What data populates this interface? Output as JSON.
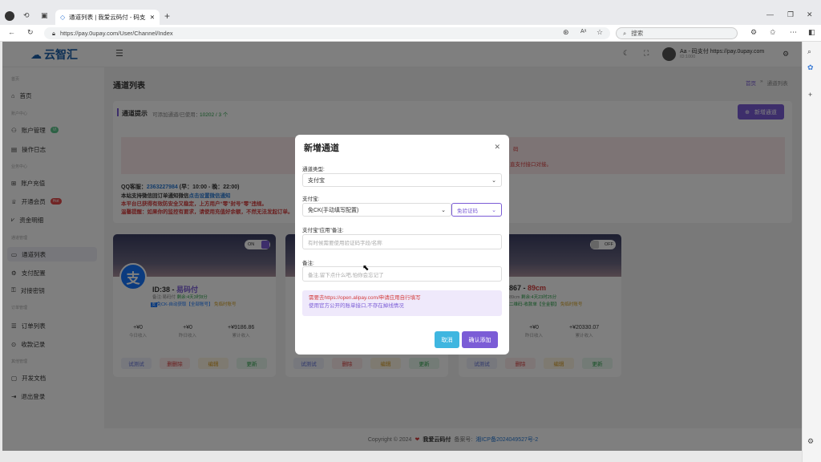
{
  "browser": {
    "tab_title": "通道列表 | 我爱云码付 - 码支二维码",
    "url": "https://pay.0upay.com/User/Channel/Index",
    "search_placeholder": "搜索"
  },
  "header": {
    "logo": "云智汇",
    "user_name": "Aa - 码支付 https://pay.0upay.com",
    "user_id": "ID:1000"
  },
  "sidebar": {
    "groups": [
      "首页",
      "账户中心",
      "业务中心",
      "通道管理",
      "订单管理",
      "其他管理"
    ],
    "items": [
      {
        "label": "首页"
      },
      {
        "label": "账户管理",
        "badge": "VI"
      },
      {
        "label": "操作日志"
      },
      {
        "label": "账户充值"
      },
      {
        "label": "开通会员",
        "badge": "Hot"
      },
      {
        "label": "资金明细"
      },
      {
        "label": "通道列表"
      },
      {
        "label": "支付配置"
      },
      {
        "label": "对接密钥"
      },
      {
        "label": "订单列表"
      },
      {
        "label": "收款记录"
      },
      {
        "label": "开发文档"
      },
      {
        "label": "退出登录"
      }
    ]
  },
  "main": {
    "title": "通道列表",
    "breadcrumb_home": "首页",
    "breadcrumb_current": "通道列表",
    "notice_label": "通道提示",
    "notice_text": "可添加通道/已使用：",
    "notice_count": "10202 / 3 个",
    "add_button": "新增通道",
    "notice_red_1": "码",
    "notice_red_2": "直支付接口对接。",
    "qq_label": "QQ客服：",
    "qq_number": "2363227984",
    "qq_hours": "(早：10:00 - 晚：22:00)",
    "line2_a": "本站支持微信回订单通知微信",
    "line2_b": "点击设置微信通知",
    "line3": "本平台已获得有效防安全又稳定，上方用户“零”封号“零”违规。",
    "line4": "温馨提醒：如果你的监控有要求，请使用充值好余额，不然无法发起订单。"
  },
  "cards": [
    {
      "toggle": "ON",
      "title_id": "ID:38 -",
      "title_name": "易码付",
      "sub1": "备注:易码付",
      "sub1b": "剩余:4天3时8分",
      "sub2": "免CK-自动获取【全部账号】",
      "sub2b": "免临时账号",
      "stats": [
        {
          "v": "+¥0",
          "l": "今日收入"
        },
        {
          "v": "+¥0",
          "l": "昨日收入"
        },
        {
          "v": "+¥9186.86",
          "l": "累计收入"
        }
      ],
      "btns": [
        "试测试",
        "删删除",
        "编辑",
        "更新"
      ]
    },
    {
      "btns": [
        "试测试",
        "删除",
        "编辑",
        "更新"
      ]
    },
    {
      "toggle": "OFF",
      "title_id": "867 -",
      "title_name": "89cm",
      "sub1": "89cm",
      "sub1b": "剩余:4天23时25分",
      "sub2": "二维码-收款单【全金额】",
      "sub2b": "免临时账号",
      "stats": [
        {
          "v": "+¥0",
          "l": "昨日收入"
        },
        {
          "v": "+¥20330.07",
          "l": "累计收入"
        }
      ],
      "btns": [
        "试测试",
        "删除",
        "编辑",
        "更新"
      ]
    }
  ],
  "footer": {
    "copyright": "Copyright © 2024",
    "site": "我爱云码付",
    "record": "备案号:",
    "icp": "湘ICP备2024049527号-2"
  },
  "modal": {
    "title": "新增通道",
    "type_label": "通道类型:",
    "type_value": "支付宝",
    "method_label": "支付宝:",
    "method_value": "免CK(手动填写配置)",
    "method_extra": "免验证码",
    "cert_label": "支付宝“应用”备注:",
    "cert_placeholder": "有时候需要使用验证码字段/名称",
    "remark_label": "备注:",
    "remark_placeholder": "备注,留下点什么吧,怕你会忘记了",
    "info_line1": "需要去https://open.alipay.com/申请应用自行填写",
    "info_line2": "使用官方公开的账单接口,不存在掉线情况",
    "cancel": "取消",
    "confirm": "确认添加"
  },
  "colors": {
    "accent": "#7b5cd6",
    "cyan": "#3fb6e0",
    "red": "#e03030"
  }
}
